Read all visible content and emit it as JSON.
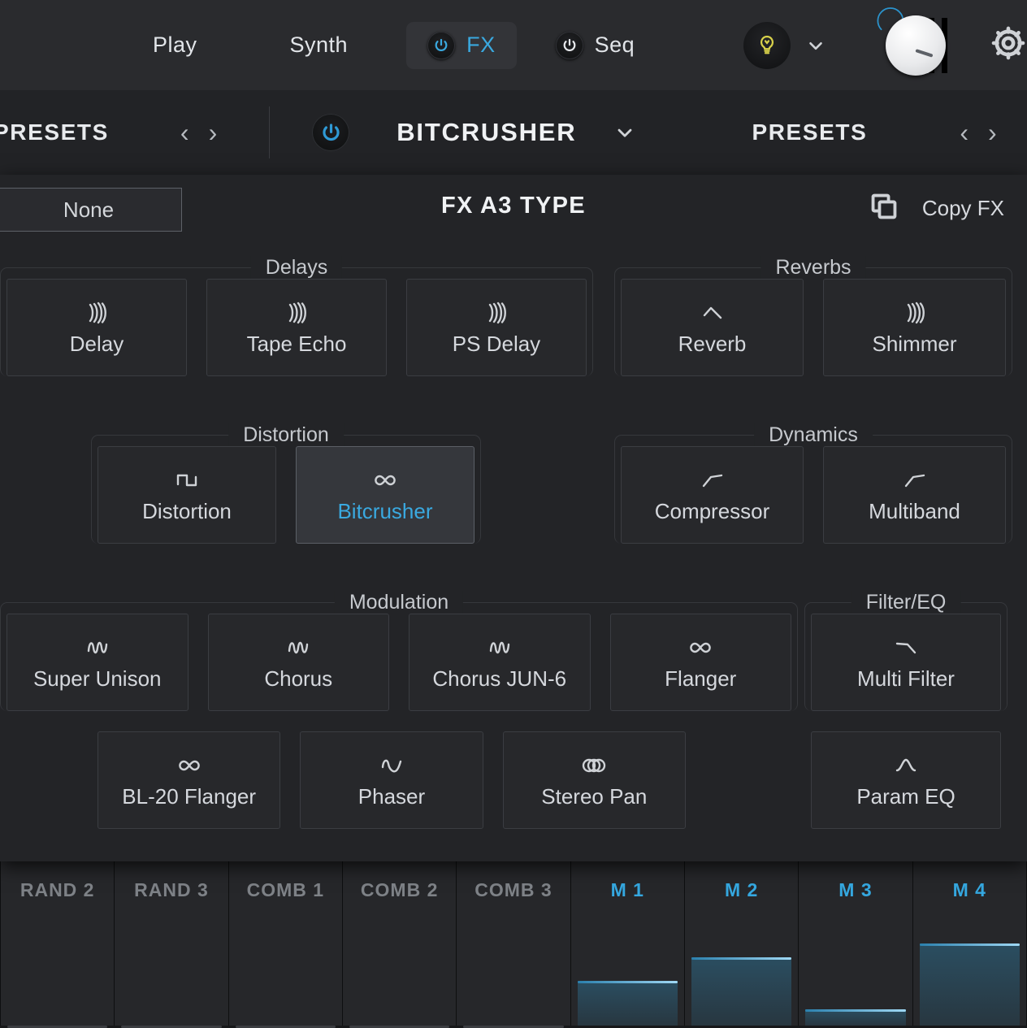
{
  "colors": {
    "accent_blue": "#3aa9e0",
    "panel_bg": "#232427",
    "tile_bg": "#27282b",
    "tile_selected_bg": "#35373c",
    "text": "#d5d8dd",
    "bulb_yellow": "#d8d14a"
  },
  "topbar": {
    "items": [
      {
        "label": "Play",
        "icon": null,
        "active": false
      },
      {
        "label": "Synth",
        "icon": null,
        "active": false
      },
      {
        "label": "FX",
        "icon": "power-icon",
        "active": true
      },
      {
        "label": "Seq",
        "icon": "power-icon",
        "active": false
      }
    ],
    "bulb_icon": "lightbulb-icon",
    "bulb_chevron_icon": "chevron-down-icon",
    "knob_icon": "master-volume-knob",
    "meter_icon": "level-meter-icon",
    "settings_icon": "gear-icon"
  },
  "presetbar": {
    "left_presets_label": "PRESETS",
    "left_prev_icon": "chevron-left-icon",
    "left_next_icon": "chevron-right-icon",
    "fx_power_icon": "power-icon",
    "fx_name": "BITCRUSHER",
    "fx_name_chevron_icon": "chevron-down-icon",
    "right_presets_label": "PRESETS",
    "right_prev_icon": "chevron-left-icon",
    "right_next_icon": "chevron-right-icon"
  },
  "panel": {
    "none_button": "None",
    "title": "FX A3 TYPE",
    "copy_icon": "copy-icon",
    "copy_label": "Copy FX"
  },
  "groups": {
    "delays": {
      "title": "Delays",
      "tiles": [
        {
          "label": "Delay",
          "icon": "echo-waves-icon",
          "selected": false
        },
        {
          "label": "Tape Echo",
          "icon": "echo-waves-icon",
          "selected": false
        },
        {
          "label": "PS Delay",
          "icon": "echo-waves-icon",
          "selected": false
        }
      ]
    },
    "reverbs": {
      "title": "Reverbs",
      "tiles": [
        {
          "label": "Reverb",
          "icon": "reverb-peak-icon",
          "selected": false
        },
        {
          "label": "Shimmer",
          "icon": "echo-waves-icon",
          "selected": false
        }
      ]
    },
    "distortion": {
      "title": "Distortion",
      "tiles": [
        {
          "label": "Distortion",
          "icon": "square-wave-icon",
          "selected": false
        },
        {
          "label": "Bitcrusher",
          "icon": "infinity-icon",
          "selected": true
        }
      ]
    },
    "dynamics": {
      "title": "Dynamics",
      "tiles": [
        {
          "label": "Compressor",
          "icon": "compression-knee-icon",
          "selected": false
        },
        {
          "label": "Multiband",
          "icon": "compression-knee-icon",
          "selected": false
        }
      ]
    },
    "modulation": {
      "title": "Modulation",
      "tiles_row1": [
        {
          "label": "Super Unison",
          "icon": "sine-wave-icon",
          "selected": false
        },
        {
          "label": "Chorus",
          "icon": "sine-wave-icon",
          "selected": false
        },
        {
          "label": "Chorus JUN-6",
          "icon": "sine-wave-icon",
          "selected": false
        },
        {
          "label": "Flanger",
          "icon": "infinity-icon",
          "selected": false
        }
      ],
      "tiles_row2": [
        {
          "label": "BL-20 Flanger",
          "icon": "infinity-icon",
          "selected": false
        },
        {
          "label": "Phaser",
          "icon": "phase-wave-icon",
          "selected": false
        },
        {
          "label": "Stereo Pan",
          "icon": "stereo-circles-icon",
          "selected": false
        }
      ]
    },
    "filter_eq": {
      "title": "Filter/EQ",
      "tiles_row1": [
        {
          "label": "Multi Filter",
          "icon": "lowpass-curve-icon",
          "selected": false
        }
      ],
      "tiles_row2": [
        {
          "label": "Param EQ",
          "icon": "bell-curve-icon",
          "selected": false
        }
      ]
    }
  },
  "modmatrix": {
    "columns": [
      {
        "label": "RAND 2",
        "active": false,
        "level": 0
      },
      {
        "label": "RAND 3",
        "active": false,
        "level": 0
      },
      {
        "label": "COMB 1",
        "active": false,
        "level": 0
      },
      {
        "label": "COMB 2",
        "active": false,
        "level": 0
      },
      {
        "label": "COMB 3",
        "active": false,
        "level": 0
      },
      {
        "label": "M 1",
        "active": true,
        "level": 38
      },
      {
        "label": "M 2",
        "active": true,
        "level": 58
      },
      {
        "label": "M 3",
        "active": true,
        "level": 14
      },
      {
        "label": "M 4",
        "active": true,
        "level": 70
      }
    ]
  }
}
